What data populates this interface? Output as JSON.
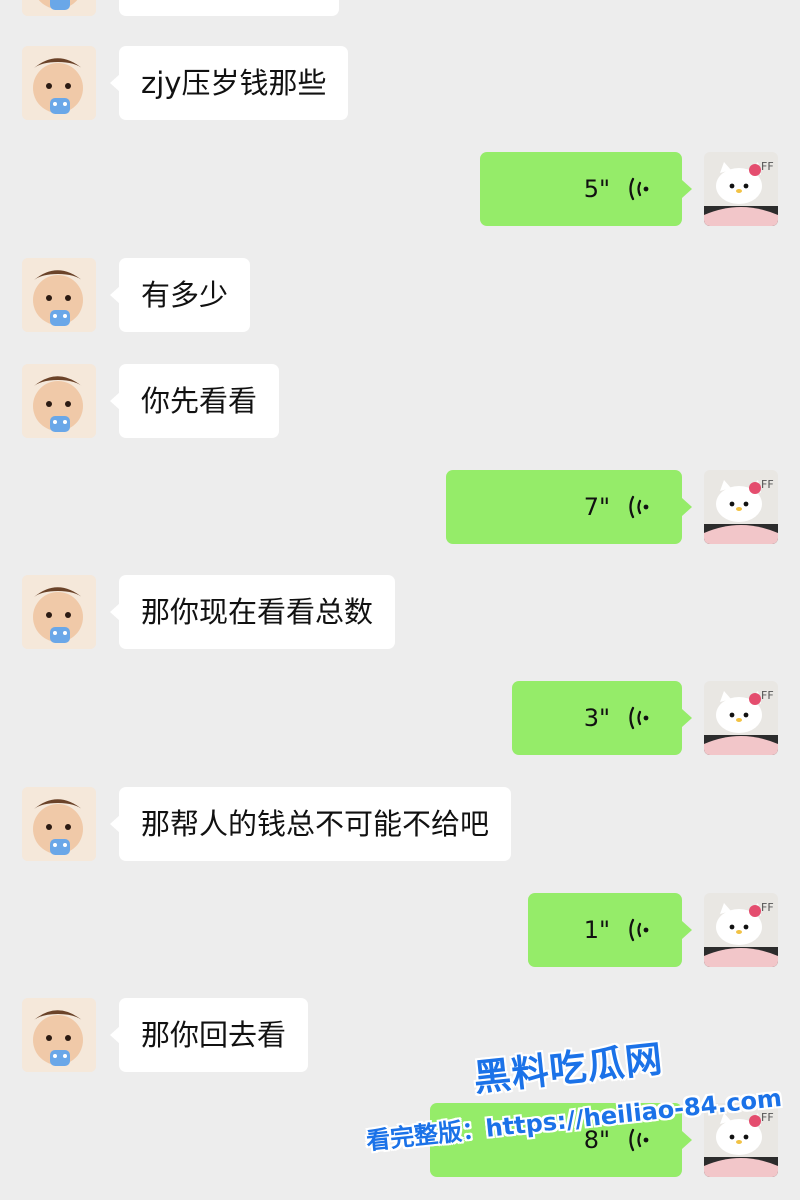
{
  "chat": {
    "messages": [
      {
        "side": "in",
        "type": "text",
        "text": "zjy压岁钱那些"
      },
      {
        "side": "out",
        "type": "voice",
        "duration": "5\""
      },
      {
        "side": "in",
        "type": "text",
        "text": "有多少"
      },
      {
        "side": "in",
        "type": "text",
        "text": "你先看看"
      },
      {
        "side": "out",
        "type": "voice",
        "duration": "7\""
      },
      {
        "side": "in",
        "type": "text",
        "text": "那你现在看看总数"
      },
      {
        "side": "out",
        "type": "voice",
        "duration": "3\""
      },
      {
        "side": "in",
        "type": "text",
        "text": "那帮人的钱总不可能不给吧"
      },
      {
        "side": "out",
        "type": "voice",
        "duration": "1\""
      },
      {
        "side": "in",
        "type": "text",
        "text": "那你回去看"
      },
      {
        "side": "out",
        "type": "voice",
        "duration": "8\""
      }
    ]
  },
  "watermark": {
    "title": "黑料吃瓜网",
    "url": "看完整版：https://heiliao-84.com"
  },
  "colors": {
    "background": "#ededed",
    "incoming_bubble": "#ffffff",
    "outgoing_bubble": "#95ec69",
    "watermark": "#1b72e8"
  },
  "icons": {
    "voice": "voice-wave-icon",
    "incoming_avatar": "baby-avatar-icon",
    "outgoing_avatar": "hello-kitty-avatar-icon"
  }
}
